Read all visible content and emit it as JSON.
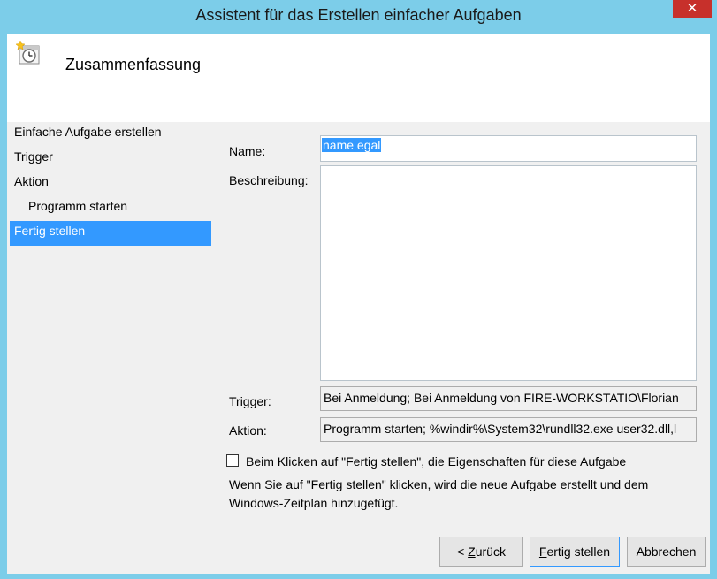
{
  "window": {
    "title": "Assistent für das Erstellen einfacher Aufgaben",
    "close_glyph": "✕"
  },
  "header": {
    "title": "Zusammenfassung",
    "icon": "task-clock-icon"
  },
  "nav": {
    "items": [
      {
        "label": "Einfache Aufgabe erstellen"
      },
      {
        "label": "Trigger"
      },
      {
        "label": "Aktion"
      },
      {
        "label": "Programm starten"
      },
      {
        "label": "Fertig stellen"
      }
    ],
    "active_index": 4
  },
  "form": {
    "name_label": "Name:",
    "name_value": "name egal",
    "description_label": "Beschreibung:",
    "description_value": "",
    "trigger_label": "Trigger:",
    "trigger_value": "Bei Anmeldung; Bei Anmeldung von FIRE-WORKSTATIO\\Florian",
    "action_label": "Aktion:",
    "action_value": "Programm starten; %windir%\\System32\\rundll32.exe user32.dll,l"
  },
  "checkbox": {
    "label": "Beim Klicken auf \"Fertig stellen\", die Eigenschaften für diese Aufgabe",
    "checked": false
  },
  "info_text_line1": "Wenn Sie auf \"Fertig stellen\" klicken, wird die neue Aufgabe erstellt und dem",
  "info_text_line2": "Windows-Zeitplan hinzugefügt.",
  "buttons": {
    "back_prefix": "< ",
    "back_mnemonic": "Z",
    "back_rest": "urück",
    "finish_mnemonic": "F",
    "finish_rest": "ertig stellen",
    "cancel": "Abbrechen"
  },
  "colors": {
    "accent": "#3399ff",
    "titlebar": "#7ccde9",
    "close": "#c7302b"
  }
}
